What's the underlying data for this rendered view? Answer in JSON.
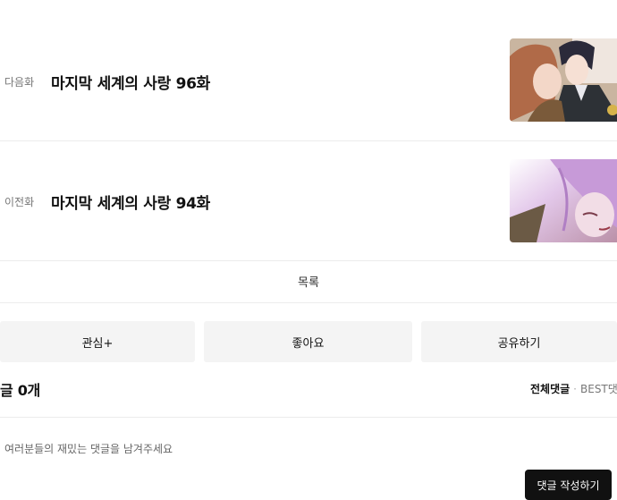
{
  "next_episode": {
    "tag": "다음화",
    "title": "마지막 세계의 사랑 96화"
  },
  "prev_episode": {
    "tag": "이전화",
    "title": "마지막 세계의 사랑 94화"
  },
  "list_label": "목록",
  "actions": {
    "interest": "관심+",
    "like": "좋아요",
    "share": "공유하기"
  },
  "comments": {
    "count_label": "글 0개",
    "filter_all": "전체댓글",
    "filter_best": "BEST댓",
    "placeholder": "여러분들의 재밌는 댓글을 남겨주세요",
    "submit_label": "댓글 작성하기"
  }
}
